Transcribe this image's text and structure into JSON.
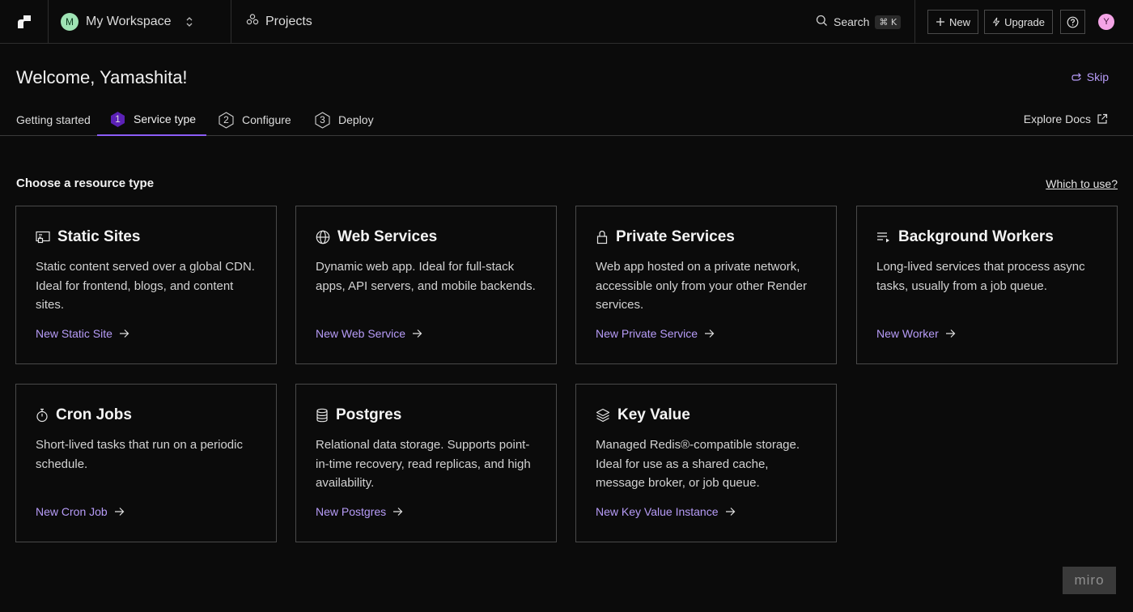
{
  "topbar": {
    "workspace_initial": "M",
    "workspace_name": "My Workspace",
    "projects_label": "Projects",
    "search_label": "Search",
    "search_shortcut": "⌘ K",
    "new_label": "New",
    "upgrade_label": "Upgrade",
    "user_initial": "Y"
  },
  "header": {
    "welcome": "Welcome, Yamashita!",
    "skip_label": "Skip",
    "explore_docs_label": "Explore Docs"
  },
  "tabs": [
    {
      "label": "Getting started",
      "step": ""
    },
    {
      "label": "Service type",
      "step": "1"
    },
    {
      "label": "Configure",
      "step": "2"
    },
    {
      "label": "Deploy",
      "step": "3"
    }
  ],
  "section": {
    "title": "Choose a resource type",
    "which_label": "Which to use?"
  },
  "cards": [
    {
      "title": "Static Sites",
      "icon": "static-site-icon",
      "desc": "Static content served over a global CDN. Ideal for frontend, blogs, and content sites.",
      "link": "New Static Site"
    },
    {
      "title": "Web Services",
      "icon": "globe-icon",
      "desc": "Dynamic web app. Ideal for full-stack apps, API servers, and mobile backends.",
      "link": "New Web Service"
    },
    {
      "title": "Private Services",
      "icon": "lock-icon",
      "desc": "Web app hosted on a private network, accessible only from your other Render services.",
      "link": "New Private Service"
    },
    {
      "title": "Background Workers",
      "icon": "list-icon",
      "desc": "Long-lived services that process async tasks, usually from a job queue.",
      "link": "New Worker"
    },
    {
      "title": "Cron Jobs",
      "icon": "stopwatch-icon",
      "desc": "Short-lived tasks that run on a periodic schedule.",
      "link": "New Cron Job"
    },
    {
      "title": "Postgres",
      "icon": "database-icon",
      "desc": "Relational data storage. Supports point-in-time recovery, read replicas, and high availability.",
      "link": "New Postgres"
    },
    {
      "title": "Key Value",
      "icon": "layers-icon",
      "desc": "Managed Redis®-compatible storage. Ideal for use as a shared cache, message broker, or job queue.",
      "link": "New Key Value Instance"
    }
  ],
  "watermark": "miro",
  "colors": {
    "accent": "#8b5cf6",
    "link": "#b79cf8",
    "background": "#0b0b0b"
  }
}
